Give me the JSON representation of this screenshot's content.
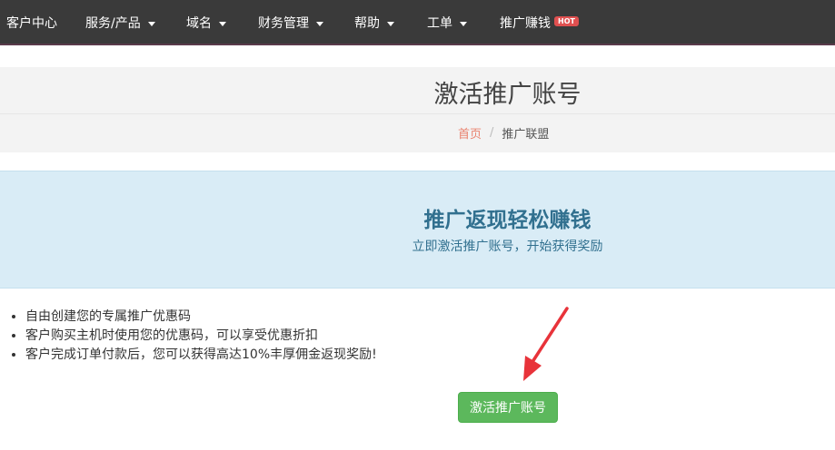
{
  "nav": {
    "items": [
      {
        "label": "客户中心",
        "dropdown": false
      },
      {
        "label": "服务/产品",
        "dropdown": true
      },
      {
        "label": "域名",
        "dropdown": true
      },
      {
        "label": "财务管理",
        "dropdown": true
      },
      {
        "label": "帮助",
        "dropdown": true
      },
      {
        "label": "工单",
        "dropdown": true
      },
      {
        "label": "推广赚钱",
        "dropdown": false,
        "badge": "HOT"
      }
    ]
  },
  "page": {
    "title": "激活推广账号",
    "breadcrumb": {
      "home": "首页",
      "separator": "/",
      "current": "推广联盟"
    }
  },
  "promo": {
    "title": "推广返现轻松赚钱",
    "subtitle": "立即激活推广账号，开始获得奖励"
  },
  "benefits": [
    "自由创建您的专属推广优惠码",
    "客户购买主机时使用您的优惠码，可以享受优惠折扣",
    "客户完成订单付款后，您可以获得高达10%丰厚佣金返现奖励!"
  ],
  "actions": {
    "activate_label": "激活推广账号"
  },
  "colors": {
    "nav_bg": "#3a3a3a",
    "promo_bg": "#d9ecf6",
    "promo_text": "#31708f",
    "button_bg": "#5cb85c",
    "link": "#e9826e",
    "arrow": "#e8333a",
    "hot_badge": "#e05050"
  }
}
